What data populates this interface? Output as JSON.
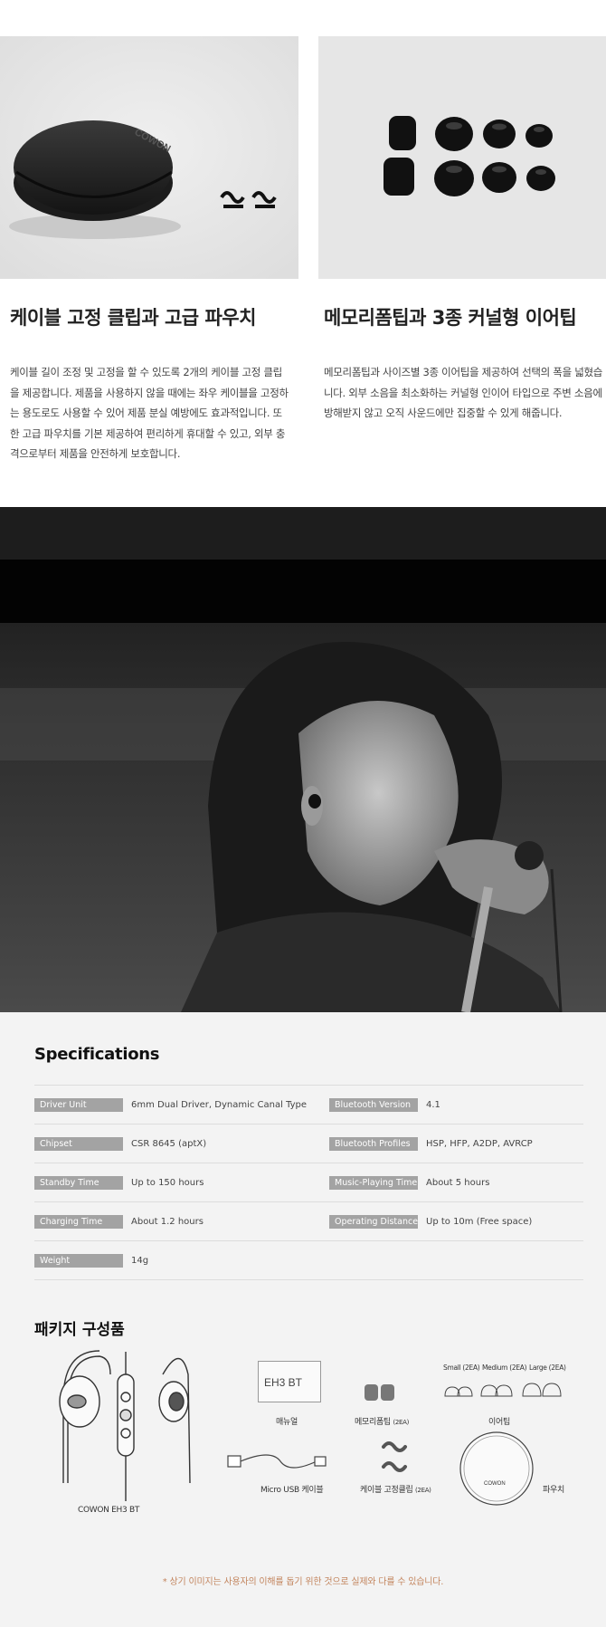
{
  "features": [
    {
      "title": "케이블 고정 클립과 고급 파우치",
      "body": "케이블 길이 조정 및 고정을 할 수 있도록 2개의 케이블 고정 클립을 제공합니다. 제품을 사용하지 않을 때에는 좌우 케이블을 고정하는 용도로도 사용할 수 있어 제품 분실 예방에도 효과적입니다. 또한 고급 파우치를 기본 제공하여 편리하게 휴대할 수 있고, 외부 충격으로부터 제품을 안전하게 보호합니다.",
      "photo_brand": "COWON"
    },
    {
      "title": "메모리폼팁과 3종 커널형 이어팁",
      "body": "메모리폼팁과 사이즈별 3종 이어팁을 제공하여 선택의 폭을 넓혔습니다. 외부 소음을 최소화하는 커널형 인이어 타입으로 주변 소음에 방해받지 않고 오직 사운드에만 집중할 수 있게 해줍니다."
    }
  ],
  "specs": {
    "title": "Specifications",
    "rows": [
      [
        {
          "label": "Driver Unit",
          "value": "6mm Dual Driver, Dynamic Canal Type"
        },
        {
          "label": "Bluetooth Version",
          "value": "4.1"
        }
      ],
      [
        {
          "label": "Chipset",
          "value": "CSR 8645 (aptX)"
        },
        {
          "label": "Bluetooth Profiles",
          "value": "HSP, HFP, A2DP, AVRCP"
        }
      ],
      [
        {
          "label": "Standby Time",
          "value": "Up to 150 hours"
        },
        {
          "label": "Music-Playing Time",
          "value": "About 5 hours"
        }
      ],
      [
        {
          "label": "Charging Time",
          "value": "About 1.2 hours"
        },
        {
          "label": "Operating Distance",
          "value": "Up to 10m (Free space)"
        }
      ],
      [
        {
          "label": "Weight",
          "value": "14g"
        }
      ]
    ]
  },
  "package": {
    "title": "패키지 구성품",
    "items": {
      "earphone": "COWON EH3 BT",
      "manual": "매뉴얼",
      "manual_cover": "EH3 BT",
      "memory_tips": "메모리폼팁",
      "memory_tips_count": "(2EA)",
      "eartips": "이어팁",
      "tip_small": "Small (2EA)",
      "tip_medium": "Medium (2EA)",
      "tip_large": "Large (2EA)",
      "usb_cable": "Micro USB 케이블",
      "cable_clip": "케이블 고정클립",
      "cable_clip_count": "(2EA)",
      "pouch": "파우치",
      "pouch_brand": "COWON"
    },
    "note": "* 상기 이미지는 사용자의 이해를 돕기 위한 것으로 실제와 다를 수 있습니다."
  },
  "colors": {
    "spec_label_bg": "#a3a3a3",
    "specs_bg": "#f3f3f3",
    "note_color": "#c3855e"
  }
}
